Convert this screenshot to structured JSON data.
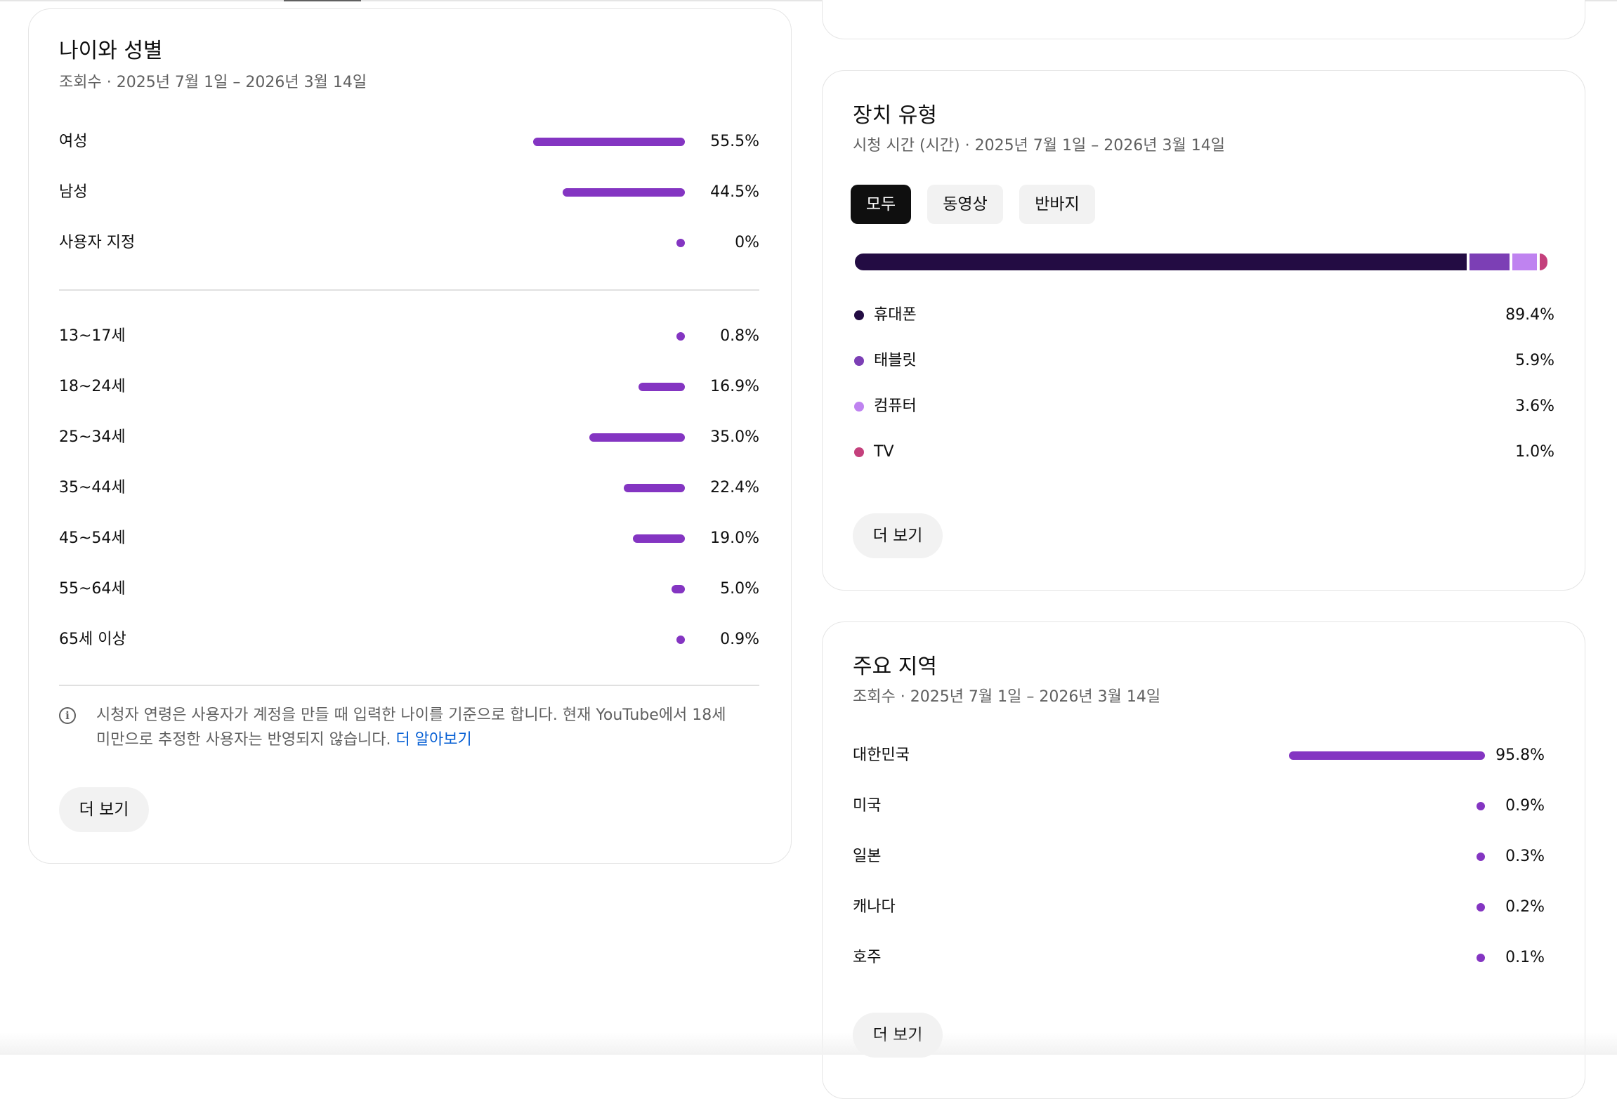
{
  "age_gender_card": {
    "title": "나이와 성별",
    "subtitle": "조회수 · 2025년 7월 1일 – 2026년 3월 14일",
    "gender_rows": [
      {
        "label": "여성",
        "value": "55.5%",
        "fraction": 0.555
      },
      {
        "label": "남성",
        "value": "44.5%",
        "fraction": 0.445
      },
      {
        "label": "사용자 지정",
        "value": "0%",
        "fraction": 0
      }
    ],
    "age_rows": [
      {
        "label": "13~17세",
        "value": "0.8%",
        "fraction": 0.008
      },
      {
        "label": "18~24세",
        "value": "16.9%",
        "fraction": 0.169
      },
      {
        "label": "25~34세",
        "value": "35.0%",
        "fraction": 0.35
      },
      {
        "label": "35~44세",
        "value": "22.4%",
        "fraction": 0.224
      },
      {
        "label": "45~54세",
        "value": "19.0%",
        "fraction": 0.19
      },
      {
        "label": "55~64세",
        "value": "5.0%",
        "fraction": 0.05
      },
      {
        "label": "65세 이상",
        "value": "0.9%",
        "fraction": 0.009
      }
    ],
    "info_text_line1": "시청자 연령은 사용자가 계정을 만들 때 입력한 나이를 기준으로 합니다. 현재 YouTube에서 18세",
    "info_text_line2": "미만으로 추정한 사용자는 반영되지 않습니다. ",
    "info_link": "더 알아보기",
    "more_button": "더 보기"
  },
  "device_card": {
    "title": "장치 유형",
    "subtitle": "시청 시간 (시간) · 2025년 7월 1일 – 2026년 3월 14일",
    "chips": [
      {
        "label": "모두",
        "selected": true
      },
      {
        "label": "동영상",
        "selected": false
      },
      {
        "label": "반바지",
        "selected": false
      }
    ],
    "devices": [
      {
        "label": "휴대폰",
        "value": "89.4%",
        "fraction": 0.894,
        "color": "#230c43"
      },
      {
        "label": "태블릿",
        "value": "5.9%",
        "fraction": 0.059,
        "color": "#7c3fb5"
      },
      {
        "label": "컴퓨터",
        "value": "3.6%",
        "fraction": 0.036,
        "color": "#bf83f0"
      },
      {
        "label": "TV",
        "value": "1.0%",
        "fraction": 0.01,
        "color": "#c4407c"
      }
    ],
    "more_button": "더 보기"
  },
  "regions_card": {
    "title": "주요 지역",
    "subtitle": "조회수 · 2025년 7월 1일 – 2026년 3월 14일",
    "rows": [
      {
        "label": "대한민국",
        "value": "95.8%",
        "fraction": 0.958
      },
      {
        "label": "미국",
        "value": "0.9%",
        "fraction": 0.009
      },
      {
        "label": "일본",
        "value": "0.3%",
        "fraction": 0.003
      },
      {
        "label": "캐나다",
        "value": "0.2%",
        "fraction": 0.002
      },
      {
        "label": "호주",
        "value": "0.1%",
        "fraction": 0.001
      }
    ],
    "more_button": "더 보기"
  },
  "colors": {
    "bar": "#8435c2",
    "chip_selected": "#0f0f0f",
    "link": "#065fd4"
  }
}
